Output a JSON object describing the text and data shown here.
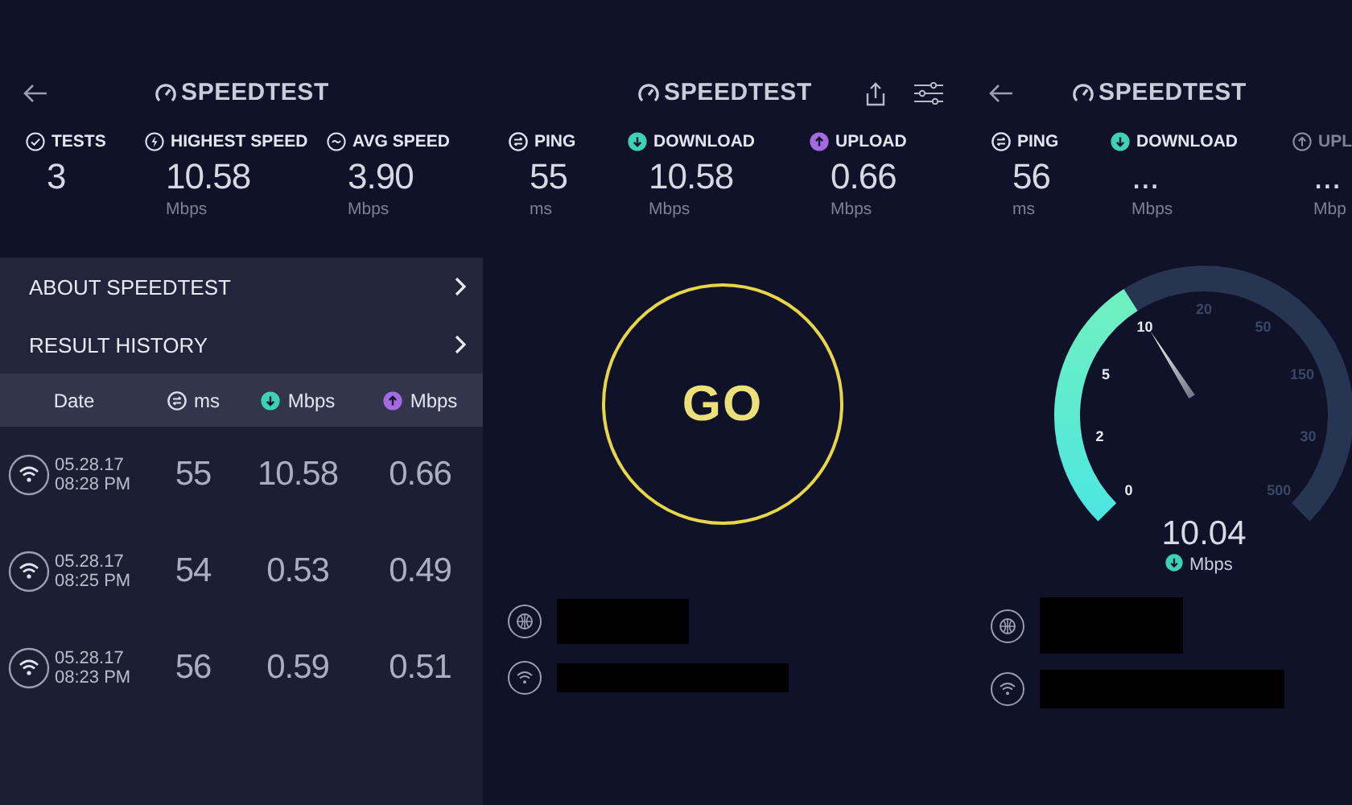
{
  "screens": [
    {
      "kind": "history",
      "logo": "SPEEDTEST",
      "stats": [
        {
          "kind": "tests",
          "label": "TESTS",
          "value": "3",
          "dimmed": false
        },
        {
          "kind": "highest",
          "label": "HIGHEST SPEED",
          "value": "10.58",
          "unit": "Mbps",
          "dimmed": false
        },
        {
          "kind": "average",
          "label": "AVG SPEED",
          "value": "3.90",
          "unit": "Mbps",
          "dimmed": false
        }
      ],
      "menu": [
        {
          "label": "ABOUT SPEEDTEST"
        },
        {
          "label": "RESULT HISTORY"
        }
      ],
      "table": {
        "columns": [
          {
            "kind": "date",
            "label": "Date"
          },
          {
            "kind": "ping",
            "label": "ms"
          },
          {
            "kind": "download",
            "label": "Mbps"
          },
          {
            "kind": "upload",
            "label": "Mbps"
          }
        ],
        "rows": [
          {
            "date": "05.28.17",
            "time": "08:28 PM",
            "ping": "55",
            "download": "10.58",
            "upload": "0.66"
          },
          {
            "date": "05.28.17",
            "time": "08:25 PM",
            "ping": "54",
            "download": "0.53",
            "upload": "0.49"
          },
          {
            "date": "05.28.17",
            "time": "08:23 PM",
            "ping": "56",
            "download": "0.59",
            "upload": "0.51"
          }
        ]
      }
    },
    {
      "kind": "start",
      "logo": "SPEEDTEST",
      "stats": [
        {
          "kind": "ping",
          "label": "PING",
          "value": "55",
          "unit": "ms",
          "dimmed": false
        },
        {
          "kind": "download",
          "label": "DOWNLOAD",
          "value": "10.58",
          "unit": "Mbps",
          "dimmed": false
        },
        {
          "kind": "upload",
          "label": "UPLOAD",
          "value": "0.66",
          "unit": "Mbps",
          "dimmed": false
        }
      ],
      "go_button": "GO"
    },
    {
      "kind": "testing",
      "logo": "SPEEDTEST",
      "stats": [
        {
          "kind": "ping",
          "label": "PING",
          "value": "56",
          "unit": "ms",
          "dimmed": false
        },
        {
          "kind": "download",
          "label": "DOWNLOAD",
          "value": "...",
          "unit": "Mbps",
          "dimmed": false
        },
        {
          "kind": "upload",
          "label": "UPL",
          "value": "...",
          "unit": "Mbp",
          "dimmed": true
        }
      ],
      "gauge": {
        "ticks": [
          "0",
          "2",
          "5",
          "10",
          "20",
          "50",
          "150",
          "30",
          "500"
        ],
        "reading": "10.04",
        "unit": "Mbps"
      }
    }
  ]
}
